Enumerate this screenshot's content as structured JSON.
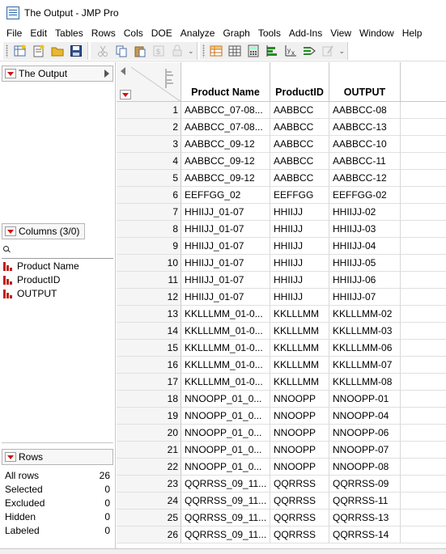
{
  "window": {
    "title": "The Output - JMP Pro"
  },
  "menu": [
    "File",
    "Edit",
    "Tables",
    "Rows",
    "Cols",
    "DOE",
    "Analyze",
    "Graph",
    "Tools",
    "Add-Ins",
    "View",
    "Window",
    "Help"
  ],
  "left_panel": {
    "table_title": "The Output",
    "columns_header": "Columns (3/0)",
    "columns": [
      "Product Name",
      "ProductID",
      "OUTPUT"
    ],
    "rows_header": "Rows",
    "row_stats": [
      {
        "label": "All rows",
        "value": "26"
      },
      {
        "label": "Selected",
        "value": "0"
      },
      {
        "label": "Excluded",
        "value": "0"
      },
      {
        "label": "Hidden",
        "value": "0"
      },
      {
        "label": "Labeled",
        "value": "0"
      }
    ]
  },
  "table": {
    "headers": [
      "Product Name",
      "ProductID",
      "OUTPUT"
    ],
    "rows": [
      [
        "1",
        "AABBCC_07-08...",
        "AABBCC",
        "AABBCC-08"
      ],
      [
        "2",
        "AABBCC_07-08...",
        "AABBCC",
        "AABBCC-13"
      ],
      [
        "3",
        "AABBCC_09-12",
        "AABBCC",
        "AABBCC-10"
      ],
      [
        "4",
        "AABBCC_09-12",
        "AABBCC",
        "AABBCC-11"
      ],
      [
        "5",
        "AABBCC_09-12",
        "AABBCC",
        "AABBCC-12"
      ],
      [
        "6",
        "EEFFGG_02",
        "EEFFGG",
        "EEFFGG-02"
      ],
      [
        "7",
        "HHIIJJ_01-07",
        "HHIIJJ",
        "HHIIJJ-02"
      ],
      [
        "8",
        "HHIIJJ_01-07",
        "HHIIJJ",
        "HHIIJJ-03"
      ],
      [
        "9",
        "HHIIJJ_01-07",
        "HHIIJJ",
        "HHIIJJ-04"
      ],
      [
        "10",
        "HHIIJJ_01-07",
        "HHIIJJ",
        "HHIIJJ-05"
      ],
      [
        "11",
        "HHIIJJ_01-07",
        "HHIIJJ",
        "HHIIJJ-06"
      ],
      [
        "12",
        "HHIIJJ_01-07",
        "HHIIJJ",
        "HHIIJJ-07"
      ],
      [
        "13",
        "KKLLLMM_01-0...",
        "KKLLLMM",
        "KKLLLMM-02"
      ],
      [
        "14",
        "KKLLLMM_01-0...",
        "KKLLLMM",
        "KKLLLMM-03"
      ],
      [
        "15",
        "KKLLLMM_01-0...",
        "KKLLLMM",
        "KKLLLMM-06"
      ],
      [
        "16",
        "KKLLLMM_01-0...",
        "KKLLLMM",
        "KKLLLMM-07"
      ],
      [
        "17",
        "KKLLLMM_01-0...",
        "KKLLLMM",
        "KKLLLMM-08"
      ],
      [
        "18",
        "NNOOPP_01_0...",
        "NNOOPP",
        "NNOOPP-01"
      ],
      [
        "19",
        "NNOOPP_01_0...",
        "NNOOPP",
        "NNOOPP-04"
      ],
      [
        "20",
        "NNOOPP_01_0...",
        "NNOOPP",
        "NNOOPP-06"
      ],
      [
        "21",
        "NNOOPP_01_0...",
        "NNOOPP",
        "NNOOPP-07"
      ],
      [
        "22",
        "NNOOPP_01_0...",
        "NNOOPP",
        "NNOOPP-08"
      ],
      [
        "23",
        "QQRRSS_09_11...",
        "QQRRSS",
        "QQRRSS-09"
      ],
      [
        "24",
        "QQRRSS_09_11...",
        "QQRRSS",
        "QQRRSS-11"
      ],
      [
        "25",
        "QQRRSS_09_11...",
        "QQRRSS",
        "QQRRSS-13"
      ],
      [
        "26",
        "QQRRSS_09_11...",
        "QQRRSS",
        "QQRRSS-14"
      ]
    ]
  },
  "colors": {
    "red_triangle": "#d01010",
    "column_icon": "#c0201a",
    "row_header_bg": "#f5f5f5"
  }
}
